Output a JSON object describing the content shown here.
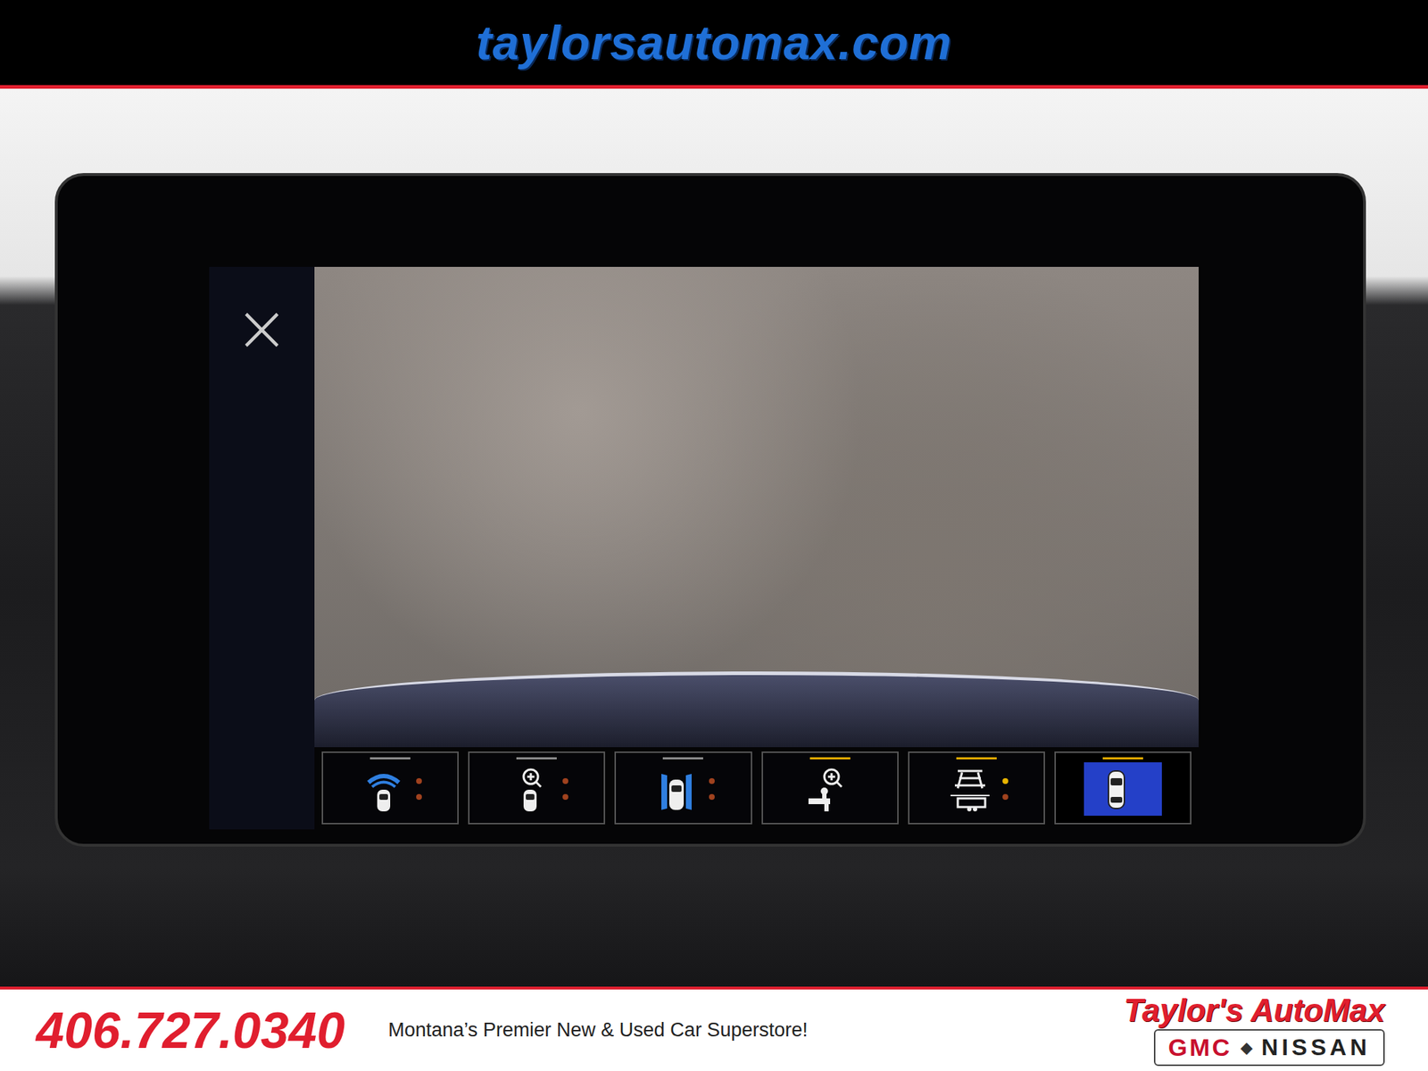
{
  "banner": {
    "url": "taylorsautomax.com",
    "phone": "406.727.0340",
    "tagline": "Montana’s Premier New & Used Car Superstore!",
    "dealer": "Taylor's AutoMax",
    "brands": [
      "GMC",
      "NISSAN"
    ],
    "separator": "◆"
  },
  "screen": {
    "close": "×",
    "view_buttons": [
      {
        "kind": "park-assist",
        "selected": false,
        "indicator": "#8a8a8a",
        "dots": [
          "#a0421e",
          "#a0421e"
        ]
      },
      {
        "kind": "rear-zoom",
        "selected": false,
        "indicator": "#8a8a8a",
        "dots": [
          "#a0421e",
          "#a0421e"
        ]
      },
      {
        "kind": "side-view",
        "selected": false,
        "indicator": "#8a8a8a",
        "dots": [
          "#a0421e",
          "#a0421e"
        ]
      },
      {
        "kind": "hitch-zoom",
        "selected": false,
        "indicator": "#e0a800",
        "dots": []
      },
      {
        "kind": "trailer",
        "selected": false,
        "indicator": "#e0a800",
        "dots": [
          "#e8b400",
          "#a0421e"
        ]
      },
      {
        "kind": "top-view",
        "selected": true,
        "indicator": "#e0a800",
        "dots": []
      }
    ]
  }
}
